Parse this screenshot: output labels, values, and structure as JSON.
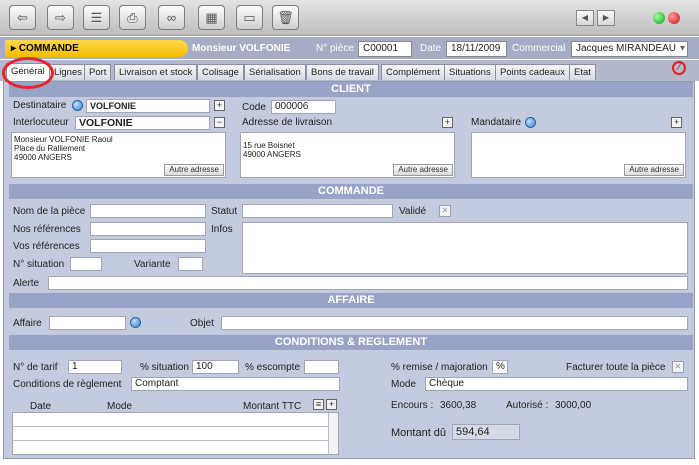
{
  "toolbar": {
    "buttons": [
      "back-icon",
      "forward-icon",
      "list-icon",
      "print-icon",
      "binoculars-icon",
      "calendar-icon",
      "book-icon",
      "trash-icon"
    ],
    "nav_prev": "◀",
    "nav_next": "▶"
  },
  "header": {
    "document_type": "COMMANDE",
    "client_name": "Monsieur VOLFONIE",
    "piece_label": "N° pièce",
    "piece_value": "C00001",
    "date_label": "Date",
    "date_value": "18/11/2009",
    "commercial_label": "Commercial",
    "commercial_value": "Jacques MIRANDEAU"
  },
  "tabs": [
    "Général",
    "Lignes",
    "Port",
    "Livraison et stock",
    "Colisage",
    "Sérialisation",
    "Bons de travail",
    "Complément",
    "Situations",
    "Points cadeaux",
    "Etat"
  ],
  "client": {
    "title": "CLIENT",
    "destinataire_label": "Destinataire",
    "destinataire_value": "VOLFONIE",
    "interlocuteur_label": "Interlocuteur",
    "interlocuteur_value": "VOLFONIE",
    "address_lines": [
      "Monsieur VOLFONIE Raoul",
      "Place du Ralliement",
      "49000 ANGERS"
    ],
    "code_label": "Code",
    "code_value": "000006",
    "livraison_label": "Adresse de livraison",
    "livraison_lines": [
      "15 rue Boisnet",
      "49000 ANGERS"
    ],
    "mandataire_label": "Mandataire",
    "autre_adresse": "Autre adresse"
  },
  "commande": {
    "title": "COMMANDE",
    "nom_piece_label": "Nom de la pièce",
    "statut_label": "Statut",
    "valide_label": "Validé",
    "nos_refs_label": "Nos références",
    "infos_label": "Infos",
    "vos_refs_label": "Vos références",
    "situation_label": "N° situation",
    "variante_label": "Variante",
    "alerte_label": "Alerte"
  },
  "affaire": {
    "title": "AFFAIRE",
    "affaire_label": "Affaire",
    "objet_label": "Objet"
  },
  "conditions": {
    "title": "CONDITIONS & REGLEMENT",
    "tarif_label": "N° de tarif",
    "tarif_value": "1",
    "pct_situation_label": "% situation",
    "pct_situation_value": "100",
    "escompte_label": "% escompte",
    "remise_label": "% remise / majoration",
    "remise_unit": "%",
    "facturer_label": "Facturer toute la pièce",
    "cond_reglement_label": "Conditions de règlement",
    "cond_reglement_value": "Comptant",
    "mode_label": "Mode",
    "mode_value": "Chèque",
    "col_date": "Date",
    "col_mode": "Mode",
    "col_montant": "Montant TTC",
    "encours_label": "Encours :",
    "encours_value": "3600,38",
    "autorise_label": "Autorisé :",
    "autorise_value": "3000,00",
    "montant_du_label": "Montant dû",
    "montant_du_value": "594,64"
  }
}
